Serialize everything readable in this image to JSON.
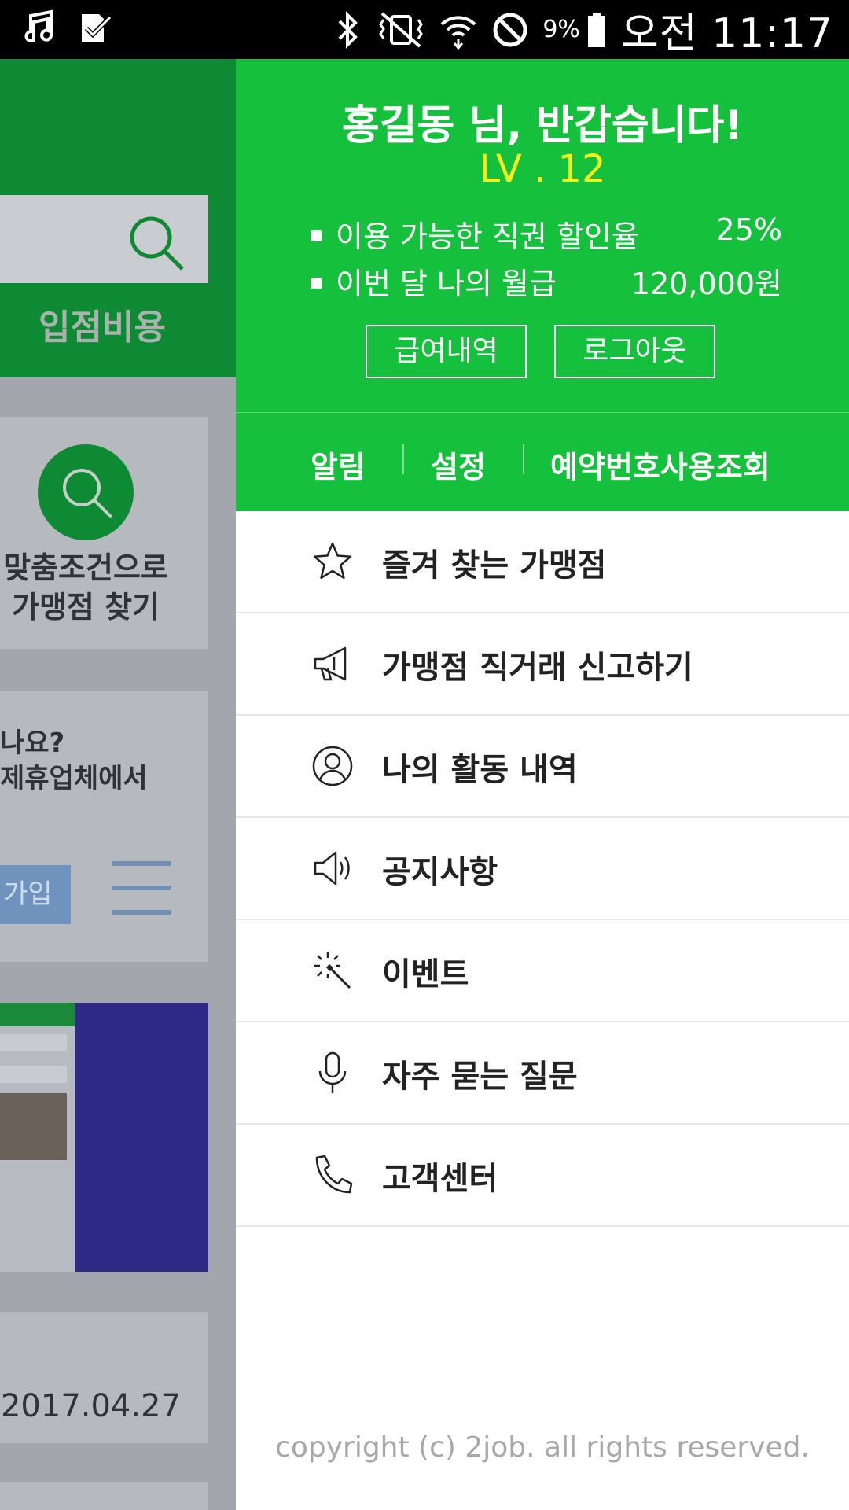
{
  "status_bar": {
    "battery_percent": "9%",
    "time": "오전 11:17",
    "icons": [
      "music-note-icon",
      "check-icon",
      "bluetooth-icon",
      "vibrate-icon",
      "wifi-icon",
      "do-not-disturb-icon",
      "battery-icon"
    ]
  },
  "background": {
    "tab_label": "입점비용",
    "find_line1": "맞춤조건으로",
    "find_line2": "가맹점 찾기",
    "promo_line1": "나요?",
    "promo_line2": "제휴업체에서",
    "join_label": "가입",
    "date": "2017.04.27"
  },
  "drawer": {
    "greeting": "홍길동 님, 반갑습니다!",
    "level": "LV . 12",
    "discount_label": "이용 가능한 직권 할인율",
    "discount_value": "25%",
    "salary_label": "이번 달 나의 월급",
    "salary_value": "120,000원",
    "pay_history_button": "급여내역",
    "logout_button": "로그아웃",
    "nav": {
      "alarm": "알림",
      "settings": "설정",
      "reservation": "예약번호사용조회"
    },
    "menu": [
      {
        "label": "즐겨 찾는 가맹점",
        "icon": "star-icon"
      },
      {
        "label": "가맹점 직거래 신고하기",
        "icon": "megaphone-icon"
      },
      {
        "label": "나의 활동 내역",
        "icon": "user-icon"
      },
      {
        "label": "공지사항",
        "icon": "speaker-icon"
      },
      {
        "label": "이벤트",
        "icon": "magic-wand-icon"
      },
      {
        "label": "자주 묻는 질문",
        "icon": "microphone-icon"
      },
      {
        "label": "고객센터",
        "icon": "phone-icon"
      }
    ],
    "copyright": "copyright (c) 2job. all rights reserved."
  },
  "colors": {
    "drawer_green": "#15c13c",
    "level_yellow": "#f8f219",
    "app_green": "#0f8a34"
  }
}
